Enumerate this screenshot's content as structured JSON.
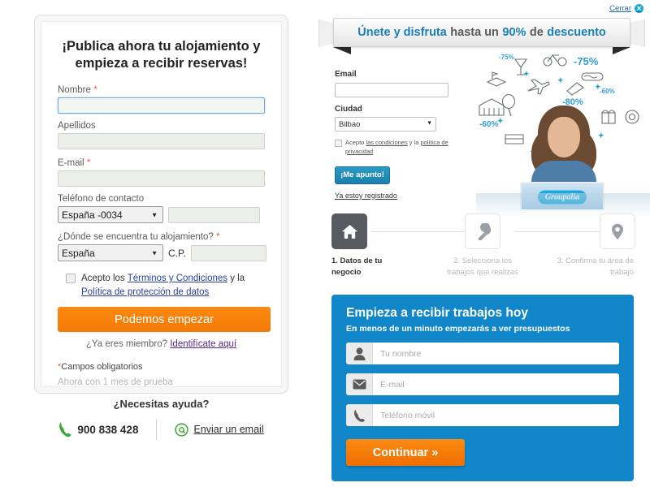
{
  "left_panel": {
    "title": "¡Publica ahora tu alojamiento y empieza a recibir reservas!",
    "fields": {
      "nombre_label": "Nombre",
      "nombre_value": "",
      "apellidos_label": "Apellidos",
      "apellidos_value": "",
      "email_label": "E-mail",
      "email_value": "",
      "telefono_label": "Teléfono de contacto",
      "telefono_prefix": "España -0034",
      "telefono_value": "",
      "ubicacion_label": "¿Dónde se encuentra tu alojamiento?",
      "pais_value": "España",
      "cp_label": "C.P.",
      "cp_value": ""
    },
    "terms": {
      "prefix": "Acepto los ",
      "link1": "Términos y Condiciones",
      "middle": " y la ",
      "link2": "Política de protección de datos"
    },
    "submit_label": "Podemos empezar",
    "member_prefix": "¿Ya eres miembro? ",
    "member_link": "Identifícate aquí",
    "required_note": "Campos obligatorios",
    "trial_note": "Ahora con 1 mes de prueba"
  },
  "help": {
    "title": "¿Necesitas ayuda?",
    "phone": "900 838 428",
    "email_link": "Enviar un email"
  },
  "right_panel": {
    "close_label": "Cerrar",
    "banner": {
      "part1": "Únete y disfruta",
      "part2": "hasta un",
      "part3": "90%",
      "part4": "de",
      "part5": "descuento"
    },
    "promo_form": {
      "email_label": "Email",
      "email_value": "",
      "ciudad_label": "Ciudad",
      "ciudad_value": "Bilbao",
      "consent_prefix": "Acepto ",
      "consent_link1": "las condiciones",
      "consent_middle": " y la ",
      "consent_link2": "política de privacidad",
      "submit_label": "¡Me apunto!",
      "already_registered": "Ya estoy registrado"
    },
    "logo_text": "Groupalia",
    "doodle_discounts": [
      "-75%",
      "-75%",
      "-60%",
      "-80%",
      "-60%"
    ],
    "steps": [
      {
        "num": "1.",
        "label": "1. Datos de tu negocio",
        "icon": "home-icon",
        "state": "active"
      },
      {
        "num": "2.",
        "label": "2. Selecciona los trabajos que realizas",
        "icon": "wrench-icon",
        "state": "idle"
      },
      {
        "num": "3.",
        "label": "3. Confirma tu área de trabajo",
        "icon": "location-pin-icon",
        "state": "idle"
      }
    ],
    "lead_form": {
      "title": "Empieza a recibir trabajos hoy",
      "subtitle": "En menos de un minuto empezarás a ver presupuestos",
      "name_placeholder": "Tu nombre",
      "name_value": "",
      "email_placeholder": "E-mail",
      "email_value": "",
      "phone_placeholder": "Teléfono móvil",
      "phone_value": "",
      "submit_label": "Continuar »"
    }
  },
  "colors": {
    "orange": "#f47a06",
    "blue_panel": "#1187c9",
    "teal_button": "#1b7fad",
    "banner_blue": "#1b7fb5",
    "required_red": "#e8604c",
    "step_active": "#575a5e"
  }
}
